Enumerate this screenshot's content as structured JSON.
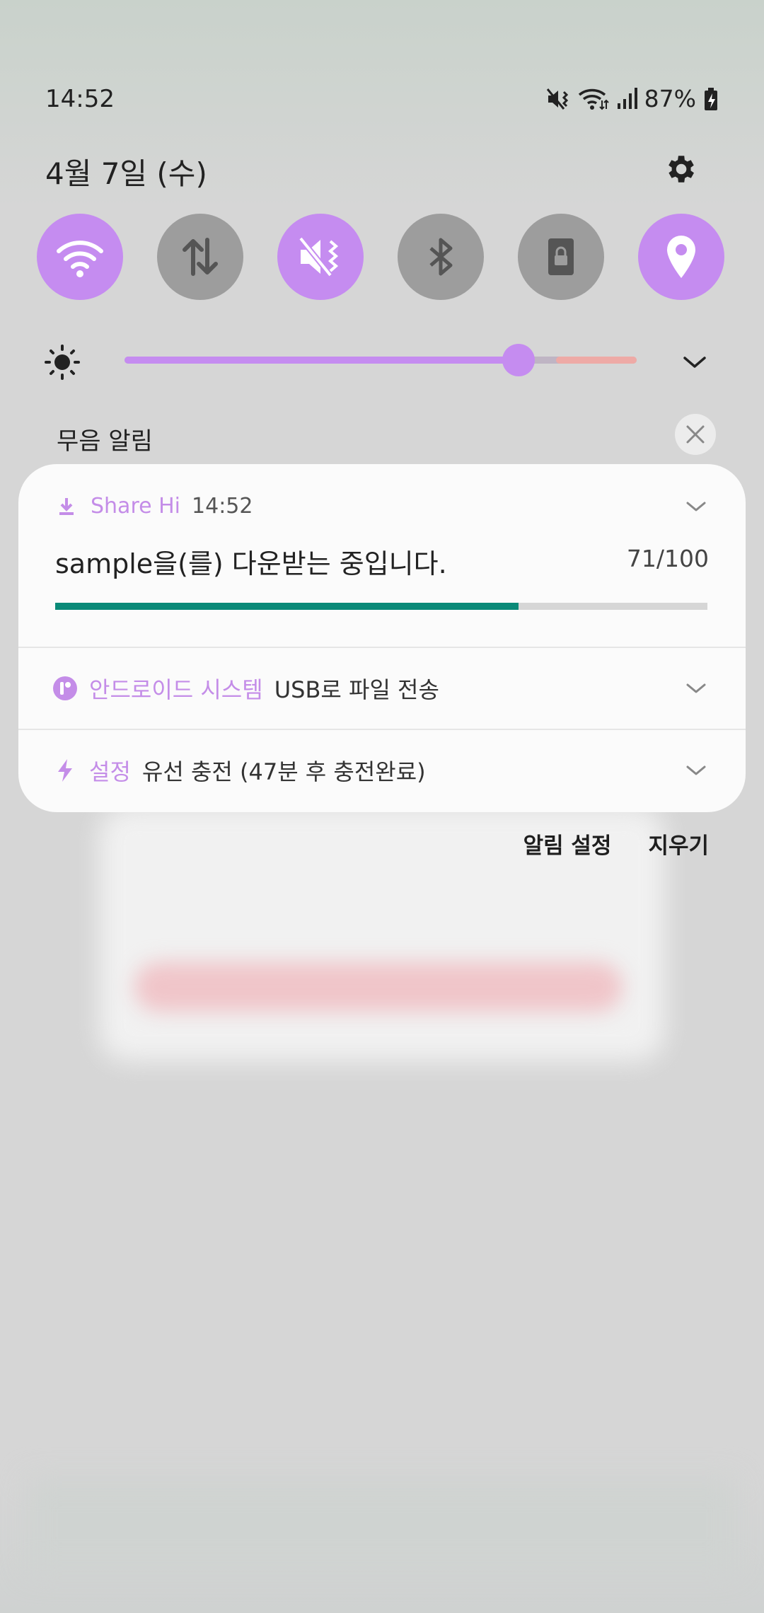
{
  "status_bar": {
    "time": "14:52",
    "battery": "87%"
  },
  "header": {
    "date": "4월 7일 (수)"
  },
  "quick_toggles": [
    {
      "name": "wifi",
      "icon": "wifi-icon",
      "state": "on"
    },
    {
      "name": "mobile-data",
      "icon": "data-transfer-icon",
      "state": "off"
    },
    {
      "name": "sound",
      "icon": "mute-vibrate-icon",
      "state": "on"
    },
    {
      "name": "bluetooth",
      "icon": "bluetooth-icon",
      "state": "off"
    },
    {
      "name": "rotation-lock",
      "icon": "lock-icon",
      "state": "off"
    },
    {
      "name": "location",
      "icon": "location-icon",
      "state": "on"
    }
  ],
  "brightness": {
    "level": 0.77
  },
  "section": {
    "title": "무음 알림"
  },
  "notifications": {
    "download": {
      "app": "Share Hi",
      "time": "14:52",
      "message": "sample을(를) 다운받는 중입니다.",
      "progress_text": "71/100",
      "progress": 0.71
    },
    "usb": {
      "app": "안드로이드 시스템",
      "text": "USB로 파일 전송"
    },
    "charging": {
      "app": "설정",
      "text": "유선 충전 (47분 후 충전완료)"
    }
  },
  "footer": {
    "settings_label": "알림 설정",
    "clear_label": "지우기"
  },
  "colors": {
    "accent": "#c58cf0",
    "app_name": "#c48de8",
    "progress": "#0a8a78",
    "toggle_off": "#9d9d9d"
  }
}
